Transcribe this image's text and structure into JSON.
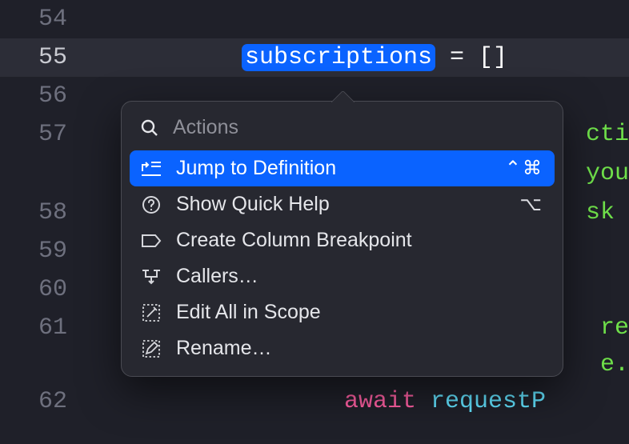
{
  "gutter": {
    "l54": "54",
    "l55": "55",
    "l56": "56",
    "l57": "57",
    "l58": "58",
    "l59": "59",
    "l60": "60",
    "l61": "61",
    "l62": "62"
  },
  "code": {
    "l55_sel": "subscriptions",
    "l55_rest": " = []",
    "l57_frag": "cti",
    "l57_frag2": "you",
    "l58_frag": "sk ",
    "l61_frag": "re",
    "l61_frag2": "e.",
    "l62_await": "await",
    "l62_call": " requestP"
  },
  "popover": {
    "actions_placeholder": "Actions",
    "items": {
      "jump": {
        "label": "Jump to Definition",
        "shortcut": "⌃⌘"
      },
      "quickhelp": {
        "label": "Show Quick Help",
        "shortcut": "⌥"
      },
      "breakpoint": {
        "label": "Create Column Breakpoint",
        "shortcut": ""
      },
      "callers": {
        "label": "Callers…",
        "shortcut": ""
      },
      "editall": {
        "label": "Edit All in Scope",
        "shortcut": ""
      },
      "rename": {
        "label": "Rename…",
        "shortcut": ""
      }
    }
  }
}
